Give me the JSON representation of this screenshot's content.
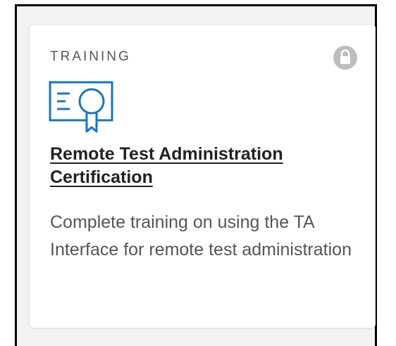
{
  "card": {
    "category": "TRAINING",
    "lock_icon": "lock-icon",
    "certificate_icon": "certificate-icon",
    "title": "Remote Test Administration Certification",
    "description": "Complete training on using the TA Interface for remote test administration"
  },
  "colors": {
    "icon_blue": "#1b75bb",
    "lock_gray": "#bdbdbd",
    "title_text": "#222222",
    "body_text": "#555555",
    "frame_border": "#000000"
  }
}
